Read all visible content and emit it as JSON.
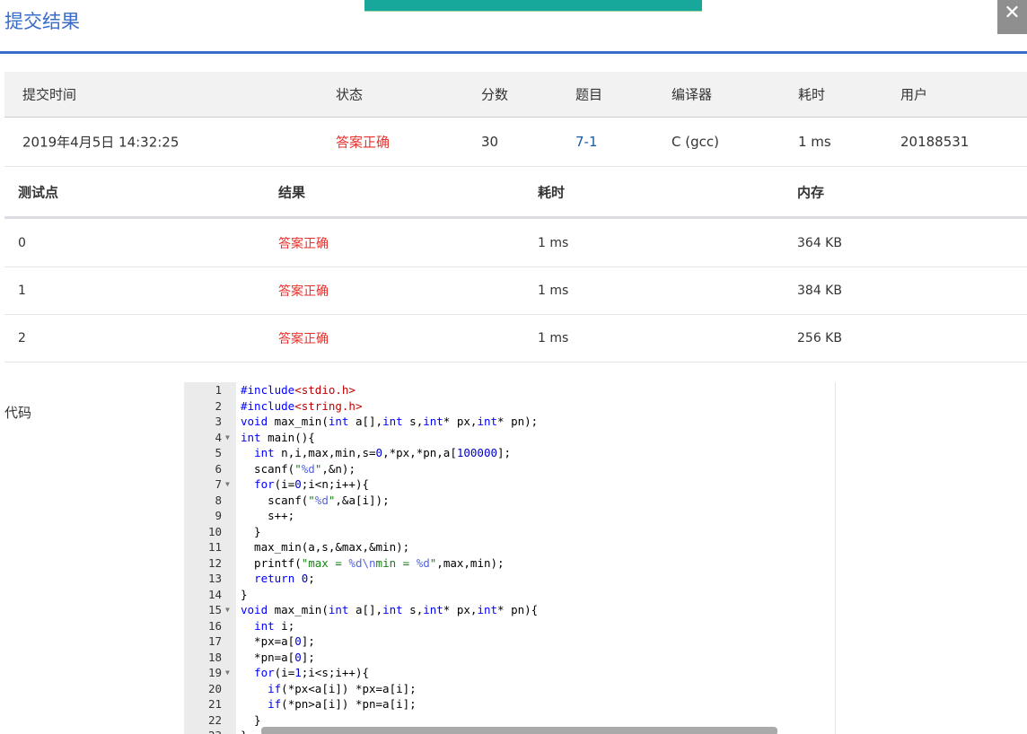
{
  "title": "提交结果",
  "close_label": "✕",
  "summary": {
    "headers": [
      "提交时间",
      "状态",
      "分数",
      "题目",
      "编译器",
      "耗时",
      "用户"
    ],
    "values": [
      "2019年4月5日 14:32:25",
      "答案正确",
      "30",
      "7-1",
      "C (gcc)",
      "1 ms",
      "20188531"
    ]
  },
  "tests": {
    "headers": [
      "测试点",
      "结果",
      "耗时",
      "内存"
    ],
    "rows": [
      [
        "0",
        "答案正确",
        "1 ms",
        "364 KB"
      ],
      [
        "1",
        "答案正确",
        "1 ms",
        "384 KB"
      ],
      [
        "2",
        "答案正确",
        "1 ms",
        "256 KB"
      ]
    ]
  },
  "code_label": "代码",
  "code": [
    "#include<stdio.h>",
    "#include<string.h>",
    "void max_min(int a[],int s,int* px,int* pn);",
    "int main(){",
    "  int n,i,max,min,s=0,*px,*pn,a[100000];",
    "  scanf(\"%d\",&n);",
    "  for(i=0;i<n;i++){",
    "    scanf(\"%d\",&a[i]);",
    "    s++;",
    "  }",
    "  max_min(a,s,&max,&min);",
    "  printf(\"max = %d\\nmin = %d\",max,min);",
    "  return 0;",
    "}",
    "void max_min(int a[],int s,int* px,int* pn){",
    "  int i;",
    "  *px=a[0];",
    "  *pn=a[0];",
    "  for(i=1;i<s;i++){",
    "    if(*px<a[i]) *px=a[i];",
    "    if(*pn>a[i]) *pn=a[i];",
    "  }",
    "}"
  ],
  "fold_lines": [
    4,
    7,
    15,
    19
  ]
}
